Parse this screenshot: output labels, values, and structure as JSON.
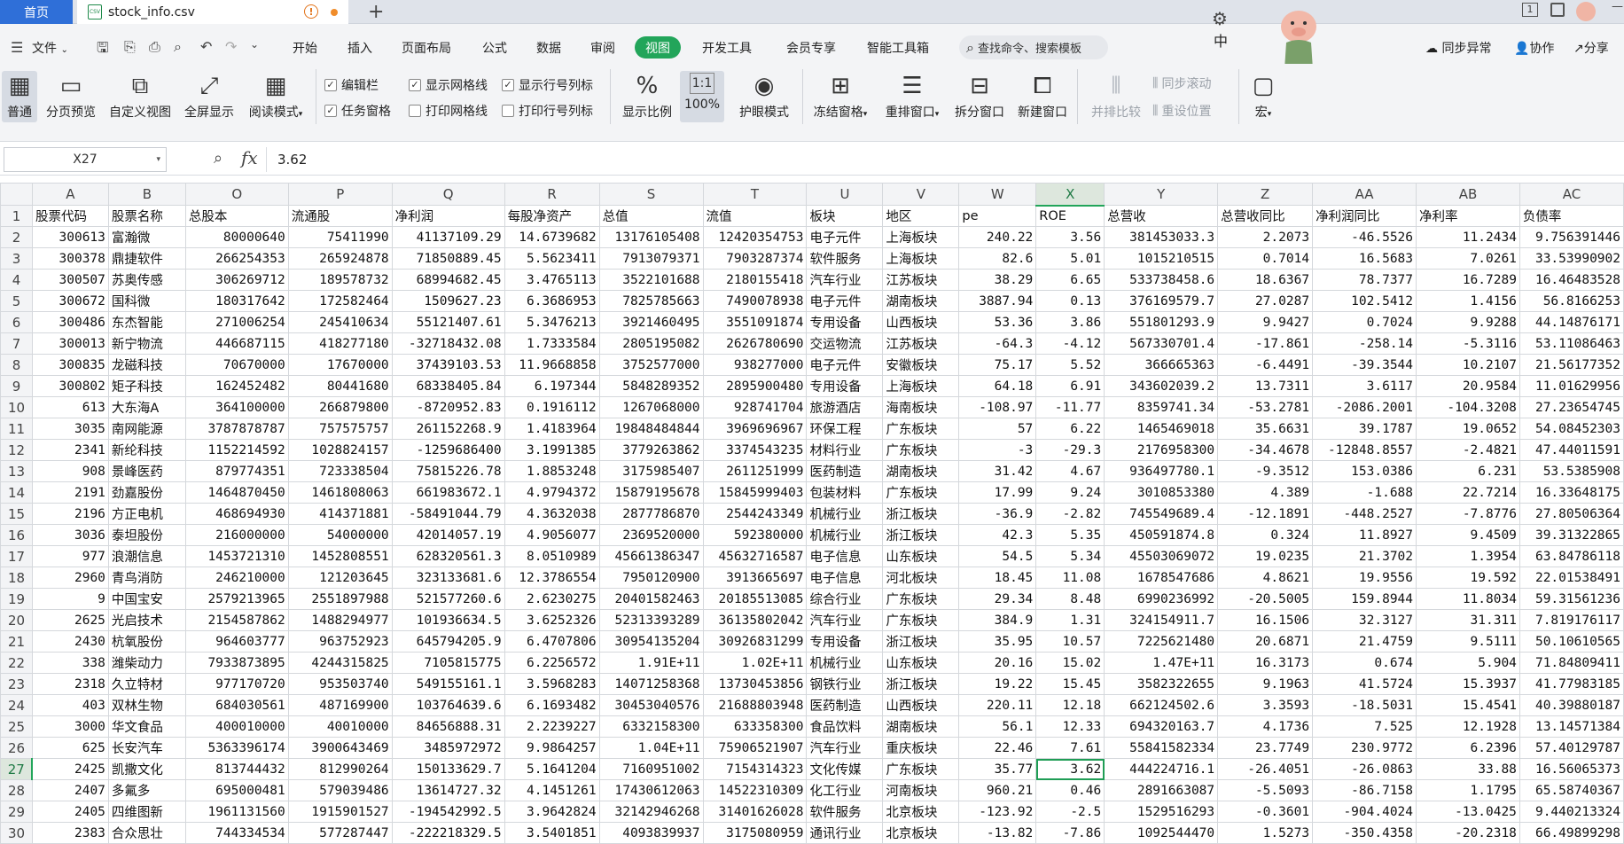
{
  "tabs": {
    "home": "首页",
    "file": "stock_info.csv"
  },
  "menu": {
    "file_label": "文件",
    "items": [
      "开始",
      "插入",
      "页面布局",
      "公式",
      "数据",
      "审阅",
      "视图",
      "开发工具",
      "会员专享",
      "智能工具箱"
    ],
    "active": "视图",
    "search_placeholder": "查找命令、搜索模板",
    "right": [
      "同步异常",
      "协作",
      "分享"
    ],
    "side_char": "中"
  },
  "ribbon": {
    "buttons": [
      "普通",
      "分页预览",
      "自定义视图",
      "全屏显示",
      "阅读模式"
    ],
    "checks": [
      {
        "label": "编辑栏",
        "checked": true
      },
      {
        "label": "任务窗格",
        "checked": true
      },
      {
        "label": "显示网格线",
        "checked": true
      },
      {
        "label": "打印网格线",
        "checked": false
      },
      {
        "label": "显示行号列标",
        "checked": true
      },
      {
        "label": "打印行号列标",
        "checked": false
      }
    ],
    "zoom_label": "显示比例",
    "zoom_value": "100%",
    "eye_label": "护眼模式",
    "freeze_label": "冻结窗格",
    "rearrange_label": "重排窗口",
    "split_label": "拆分窗口",
    "newwin_label": "新建窗口",
    "side_label": "并排比较",
    "sync_label": "同步滚动",
    "reset_label": "重设位置",
    "macro_label": "宏"
  },
  "formula": {
    "cell_ref": "X27",
    "fx": "fx",
    "value": "3.62"
  },
  "sheet": {
    "col_letters": [
      "A",
      "B",
      "O",
      "P",
      "Q",
      "R",
      "S",
      "T",
      "U",
      "V",
      "W",
      "X",
      "Y",
      "Z",
      "AA",
      "AB",
      "AC"
    ],
    "selected_col": "X",
    "selected_row": "27",
    "header": [
      "股票代码",
      "股票名称",
      "总股本",
      "流通股",
      "净利润",
      "每股净资产",
      "总值",
      "流值",
      "板块",
      "地区",
      "pe",
      "ROE",
      "总营收",
      "总营收同比",
      "净利润同比",
      "净利率",
      "负债率"
    ],
    "rows": [
      [
        "2",
        "300613",
        "富瀚微",
        "80000640",
        "75411990",
        "41137109.29",
        "14.6739682",
        "13176105408",
        "12420354753",
        "电子元件",
        "上海板块",
        "240.22",
        "3.56",
        "381453033.3",
        "2.2073",
        "-46.5526",
        "11.2434",
        "9.756391446"
      ],
      [
        "3",
        "300378",
        "鼎捷软件",
        "266254353",
        "265924878",
        "71850889.45",
        "5.5623411",
        "7913079371",
        "7903287374",
        "软件服务",
        "上海板块",
        "82.6",
        "5.01",
        "1015210515",
        "0.7014",
        "16.5683",
        "7.0261",
        "33.53990902"
      ],
      [
        "4",
        "300507",
        "苏奥传感",
        "306269712",
        "189578732",
        "68994682.45",
        "3.4765113",
        "3522101688",
        "2180155418",
        "汽车行业",
        "江苏板块",
        "38.29",
        "6.65",
        "533738458.6",
        "18.6367",
        "78.7377",
        "16.7289",
        "16.46483528"
      ],
      [
        "5",
        "300672",
        "国科微",
        "180317642",
        "172582464",
        "1509627.23",
        "6.3686953",
        "7825785663",
        "7490078938",
        "电子元件",
        "湖南板块",
        "3887.94",
        "0.13",
        "376169579.7",
        "27.0287",
        "102.5412",
        "1.4156",
        "56.8166253"
      ],
      [
        "6",
        "300486",
        "东杰智能",
        "271006254",
        "245410634",
        "55121407.61",
        "5.3476213",
        "3921460495",
        "3551091874",
        "专用设备",
        "山西板块",
        "53.36",
        "3.86",
        "551801293.9",
        "9.9427",
        "0.7024",
        "9.9288",
        "44.14876171"
      ],
      [
        "7",
        "300013",
        "新宁物流",
        "446687115",
        "418277180",
        "-32718432.08",
        "1.7333584",
        "2805195082",
        "2626780690",
        "交运物流",
        "江苏板块",
        "-64.3",
        "-4.12",
        "567330701.4",
        "-17.861",
        "-258.14",
        "-5.3116",
        "53.11086463"
      ],
      [
        "8",
        "300835",
        "龙磁科技",
        "70670000",
        "17670000",
        "37439103.53",
        "11.9668858",
        "3752577000",
        "938277000",
        "电子元件",
        "安徽板块",
        "75.17",
        "5.52",
        "366665363",
        "-6.4491",
        "-39.3544",
        "10.2107",
        "21.56177352"
      ],
      [
        "9",
        "300802",
        "矩子科技",
        "162452482",
        "80441680",
        "68338405.84",
        "6.197344",
        "5848289352",
        "2895900480",
        "专用设备",
        "上海板块",
        "64.18",
        "6.91",
        "343602039.2",
        "13.7311",
        "3.6117",
        "20.9584",
        "11.01629956"
      ],
      [
        "10",
        "613",
        "大东海A",
        "364100000",
        "266879800",
        "-8720952.83",
        "0.1916112",
        "1267068000",
        "928741704",
        "旅游酒店",
        "海南板块",
        "-108.97",
        "-11.77",
        "8359741.34",
        "-53.2781",
        "-2086.2001",
        "-104.3208",
        "27.23654745"
      ],
      [
        "11",
        "3035",
        "南网能源",
        "3787878787",
        "757575757",
        "261152268.9",
        "1.4183964",
        "19848484844",
        "3969696967",
        "环保工程",
        "广东板块",
        "57",
        "6.22",
        "1465469018",
        "35.6631",
        "39.1787",
        "19.0652",
        "54.08452303"
      ],
      [
        "12",
        "2341",
        "新纶科技",
        "1152214592",
        "1028824157",
        "-1259686400",
        "3.1991385",
        "3779263862",
        "3374543235",
        "材料行业",
        "广东板块",
        "-3",
        "-29.3",
        "2176958300",
        "-34.4678",
        "-12848.8557",
        "-2.4821",
        "47.44011591"
      ],
      [
        "13",
        "908",
        "景峰医药",
        "879774351",
        "723338504",
        "75815226.78",
        "1.8853248",
        "3175985407",
        "2611251999",
        "医药制造",
        "湖南板块",
        "31.42",
        "4.67",
        "936497780.1",
        "-9.3512",
        "153.0386",
        "6.231",
        "53.5385908"
      ],
      [
        "14",
        "2191",
        "劲嘉股份",
        "1464870450",
        "1461808063",
        "661983672.1",
        "4.9794372",
        "15879195678",
        "15845999403",
        "包装材料",
        "广东板块",
        "17.99",
        "9.24",
        "3010853380",
        "4.389",
        "-1.688",
        "22.7214",
        "16.33648175"
      ],
      [
        "15",
        "2196",
        "方正电机",
        "468694930",
        "414371881",
        "-58491044.79",
        "4.3632038",
        "2877786870",
        "2544243349",
        "机械行业",
        "浙江板块",
        "-36.9",
        "-2.82",
        "745549689.4",
        "-12.1891",
        "-448.2527",
        "-7.8776",
        "27.80506364"
      ],
      [
        "16",
        "3036",
        "泰坦股份",
        "216000000",
        "54000000",
        "42014057.19",
        "4.9056077",
        "2369520000",
        "592380000",
        "机械行业",
        "浙江板块",
        "42.3",
        "5.35",
        "450591874.8",
        "0.324",
        "11.8927",
        "9.4509",
        "39.31322865"
      ],
      [
        "17",
        "977",
        "浪潮信息",
        "1453721310",
        "1452808551",
        "628320561.3",
        "8.0510989",
        "45661386347",
        "45632716587",
        "电子信息",
        "山东板块",
        "54.5",
        "5.34",
        "45503069072",
        "19.0235",
        "21.3702",
        "1.3954",
        "63.84786118"
      ],
      [
        "18",
        "2960",
        "青鸟消防",
        "246210000",
        "121203645",
        "323133681.6",
        "12.3786554",
        "7950120900",
        "3913665697",
        "电子信息",
        "河北板块",
        "18.45",
        "11.08",
        "1678547686",
        "4.8621",
        "19.9556",
        "19.592",
        "22.01538491"
      ],
      [
        "19",
        "9",
        "中国宝安",
        "2579213965",
        "2551897988",
        "521577260.6",
        "2.6230275",
        "20401582463",
        "20185513085",
        "综合行业",
        "广东板块",
        "29.34",
        "8.48",
        "6990236992",
        "-20.5005",
        "159.8944",
        "11.8034",
        "59.31561236"
      ],
      [
        "20",
        "2625",
        "光启技术",
        "2154587862",
        "1488294977",
        "101936634.5",
        "3.6252326",
        "52313393289",
        "36135802042",
        "汽车行业",
        "广东板块",
        "384.9",
        "1.31",
        "324154911.7",
        "16.1506",
        "32.3127",
        "31.311",
        "7.819176117"
      ],
      [
        "21",
        "2430",
        "杭氧股份",
        "964603777",
        "963752923",
        "645794205.9",
        "6.4707806",
        "30954135204",
        "30926831299",
        "专用设备",
        "浙江板块",
        "35.95",
        "10.57",
        "7225621480",
        "20.6871",
        "21.4759",
        "9.5111",
        "50.10610565"
      ],
      [
        "22",
        "338",
        "潍柴动力",
        "7933873895",
        "4244315825",
        "7105815775",
        "6.2256572",
        "1.91E+11",
        "1.02E+11",
        "机械行业",
        "山东板块",
        "20.16",
        "15.02",
        "1.47E+11",
        "16.3173",
        "0.674",
        "5.904",
        "71.84809411"
      ],
      [
        "23",
        "2318",
        "久立特材",
        "977170720",
        "953503740",
        "549155161.1",
        "3.5968283",
        "14071258368",
        "13730453856",
        "钢铁行业",
        "浙江板块",
        "19.22",
        "15.45",
        "3582322655",
        "9.1963",
        "41.5724",
        "15.3937",
        "41.77983185"
      ],
      [
        "24",
        "403",
        "双林生物",
        "684030561",
        "487169900",
        "103764639.6",
        "6.1693482",
        "30453040576",
        "21688803948",
        "医药制造",
        "山西板块",
        "220.11",
        "12.18",
        "662124502.6",
        "3.3593",
        "-18.5031",
        "15.4541",
        "40.39880187"
      ],
      [
        "25",
        "3000",
        "华文食品",
        "400010000",
        "40010000",
        "84656888.31",
        "2.2239227",
        "6332158300",
        "633358300",
        "食品饮料",
        "湖南板块",
        "56.1",
        "12.33",
        "694320163.7",
        "4.1736",
        "7.525",
        "12.1928",
        "13.14571384"
      ],
      [
        "26",
        "625",
        "长安汽车",
        "5363396174",
        "3900643469",
        "3485972972",
        "9.9864257",
        "1.04E+11",
        "75906521907",
        "汽车行业",
        "重庆板块",
        "22.46",
        "7.61",
        "55841582334",
        "23.7749",
        "230.9772",
        "6.2396",
        "57.40129787"
      ],
      [
        "27",
        "2425",
        "凯撒文化",
        "813744432",
        "812990264",
        "150133629.7",
        "5.1641204",
        "7160951002",
        "7154314323",
        "文化传媒",
        "广东板块",
        "35.77",
        "3.62",
        "444224716.1",
        "-26.4051",
        "-26.0863",
        "33.88",
        "16.56065373"
      ],
      [
        "28",
        "2407",
        "多氟多",
        "695000481",
        "579039486",
        "13614727.32",
        "4.1451261",
        "17430612063",
        "14522310309",
        "化工行业",
        "河南板块",
        "960.21",
        "0.46",
        "2891663087",
        "-5.5093",
        "-86.7158",
        "1.1795",
        "65.58740367"
      ],
      [
        "29",
        "2405",
        "四维图新",
        "1961131560",
        "1915901527",
        "-194542992.5",
        "3.9642824",
        "32142946268",
        "31401626028",
        "软件服务",
        "北京板块",
        "-123.92",
        "-2.5",
        "1529516293",
        "-0.3601",
        "-904.4024",
        "-13.0425",
        "9.440213324"
      ],
      [
        "30",
        "2383",
        "合众思壮",
        "744334534",
        "577287447",
        "-222218329.5",
        "3.5401851",
        "4093839937",
        "3175080959",
        "通讯行业",
        "北京板块",
        "-13.82",
        "-7.86",
        "1092544470",
        "1.5273",
        "-350.4358",
        "-20.2318",
        "66.49899298"
      ]
    ]
  }
}
